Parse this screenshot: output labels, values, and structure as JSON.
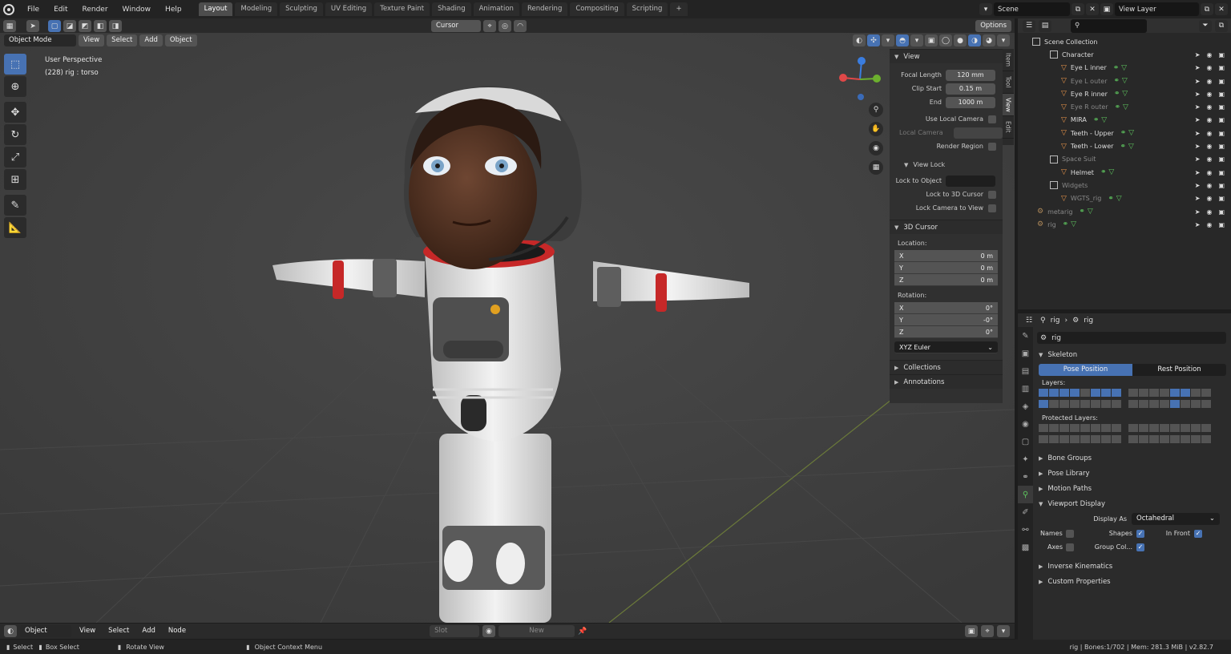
{
  "menus": [
    "File",
    "Edit",
    "Render",
    "Window",
    "Help"
  ],
  "workspace_tabs": [
    "Layout",
    "Modeling",
    "Sculpting",
    "UV Editing",
    "Texture Paint",
    "Shading",
    "Animation",
    "Rendering",
    "Compositing",
    "Scripting"
  ],
  "add_tab": "+",
  "scene": "Scene",
  "view_layer": "View Layer",
  "viewport": {
    "mode": "Object Mode",
    "menu": [
      "View",
      "Select",
      "Add",
      "Object"
    ],
    "transform": "Cursor",
    "options": "Options",
    "overlay_line1": "User Perspective",
    "overlay_line2": "(228) rig : torso"
  },
  "npanel": {
    "tabs": [
      "Item",
      "Tool",
      "View",
      "Edit"
    ],
    "view_section": "View",
    "focal_length_label": "Focal Length",
    "focal_length": "120 mm",
    "clip_start_label": "Clip Start",
    "clip_start": "0.15 m",
    "end_label": "End",
    "end": "1000 m",
    "use_local_camera": "Use Local Camera",
    "local_camera": "Local Camera",
    "render_region": "Render Region",
    "view_lock": "View Lock",
    "lock_to_object": "Lock to Object",
    "lock_to_3d_cursor": "Lock to 3D Cursor",
    "lock_camera_to_view": "Lock Camera to View",
    "cursor_section": "3D Cursor",
    "location_label": "Location:",
    "location": [
      {
        "axis": "X",
        "value": "0 m"
      },
      {
        "axis": "Y",
        "value": "0 m"
      },
      {
        "axis": "Z",
        "value": "0 m"
      }
    ],
    "rotation_label": "Rotation:",
    "rotation": [
      {
        "axis": "X",
        "value": "0°"
      },
      {
        "axis": "Y",
        "value": "-0°"
      },
      {
        "axis": "Z",
        "value": "0°"
      }
    ],
    "rotation_mode": "XYZ Euler",
    "collections": "Collections",
    "annotations": "Annotations"
  },
  "outliner": {
    "root": "Scene Collection",
    "items": [
      {
        "name": "Character",
        "dim": false
      },
      {
        "name": "Eye L inner",
        "dim": false
      },
      {
        "name": "Eye L outer",
        "dim": true
      },
      {
        "name": "Eye R inner",
        "dim": false
      },
      {
        "name": "Eye R outer",
        "dim": true
      },
      {
        "name": "MIRA",
        "dim": false
      },
      {
        "name": "Teeth - Upper",
        "dim": false
      },
      {
        "name": "Teeth - Lower",
        "dim": false
      },
      {
        "name": "Space Suit",
        "dim": true
      },
      {
        "name": "Helmet",
        "dim": false
      },
      {
        "name": "Widgets",
        "dim": true
      },
      {
        "name": "WGTS_rig",
        "dim": true
      },
      {
        "name": "metarig",
        "dim": true
      },
      {
        "name": "rig",
        "dim": true
      }
    ]
  },
  "properties": {
    "breadcrumb1": "rig",
    "breadcrumb2": "rig",
    "data_name": "rig",
    "skeleton": "Skeleton",
    "pose_position": "Pose Position",
    "rest_position": "Rest Position",
    "layers_label": "Layers:",
    "protected_layers_label": "Protected Layers:",
    "bone_groups": "Bone Groups",
    "pose_library": "Pose Library",
    "motion_paths": "Motion Paths",
    "viewport_display": "Viewport Display",
    "display_as_label": "Display As",
    "display_as": "Octahedral",
    "names": "Names",
    "shapes": "Shapes",
    "in_front": "In Front",
    "axes": "Axes",
    "group_colors": "Group Col...",
    "inverse_kinematics": "Inverse Kinematics",
    "custom_properties": "Custom Properties"
  },
  "timeline": {
    "editor": "Object",
    "menu": [
      "View",
      "Select",
      "Add",
      "Node"
    ],
    "slot": "Slot",
    "new": "New"
  },
  "status": {
    "select": "Select",
    "box_select": "Box Select",
    "rotate_view": "Rotate View",
    "context_menu": "Object Context Menu",
    "stats": "rig | Bones:1/702 | Mem: 281.3 MiB | v2.82.7"
  }
}
